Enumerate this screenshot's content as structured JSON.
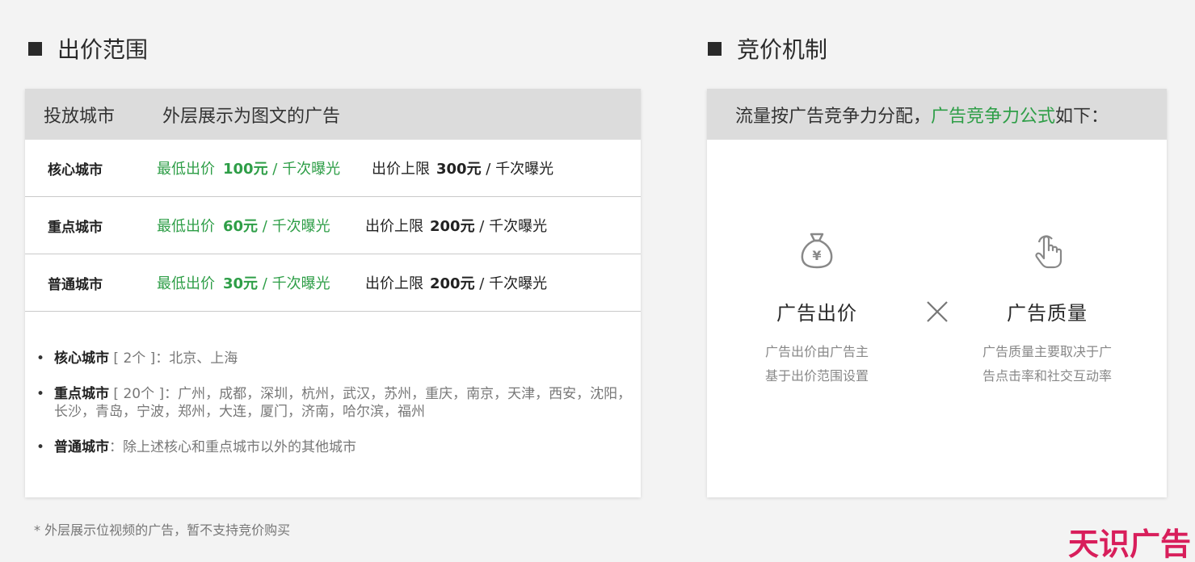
{
  "left_section": {
    "title": "出价范围",
    "table": {
      "header": [
        "投放城市",
        "外层展示为图文的广告"
      ],
      "rows": [
        {
          "city": "核心城市",
          "min_label": "最低出价",
          "min_value": "100元",
          "min_unit": " / 千次曝光",
          "max_label": "出价上限",
          "max_value": "300元",
          "max_unit": " / 千次曝光"
        },
        {
          "city": "重点城市",
          "min_label": "最低出价",
          "min_value": "60元",
          "min_unit": " / 千次曝光",
          "max_label": "出价上限",
          "max_value": "200元",
          "max_unit": " / 千次曝光"
        },
        {
          "city": "普通城市",
          "min_label": "最低出价",
          "min_value": "30元",
          "min_unit": " / 千次曝光",
          "max_label": "出价上限",
          "max_value": "200元",
          "max_unit": " / 千次曝光"
        }
      ]
    },
    "bullets": [
      {
        "key": "核心城市",
        "count": " [ 2个 ]",
        "text": "：北京、上海"
      },
      {
        "key": "重点城市",
        "count": " [ 20个 ]",
        "text": "：广州，成都，深圳，杭州，武汉，苏州，重庆，南京，天津，西安，沈阳，长沙，青岛，宁波，郑州，大连，厦门，济南，哈尔滨，福州"
      },
      {
        "key": "普通城市",
        "count": "",
        "text": "：除上述核心和重点城市以外的其他城市"
      }
    ],
    "note": "* 外层展示位视频的广告，暂不支持竞价购买"
  },
  "right_section": {
    "title": "竞价机制",
    "header_prefix": "流量按广告竞争力分配，",
    "header_highlight": "广告竞争力公式",
    "header_suffix": "如下：",
    "factors": [
      {
        "icon": "money-bag-icon",
        "title": "广告出价",
        "desc_line1": "广告出价由广告主",
        "desc_line2": "基于出价范围设置"
      },
      {
        "icon": "tap-hand-icon",
        "title": "广告质量",
        "desc_line1": "广告质量主要取决于广",
        "desc_line2": "告点击率和社交互动率"
      }
    ],
    "operator_icon": "multiply-icon"
  },
  "logo": "天识广告",
  "colors": {
    "accent_green": "#2e9e47",
    "logo_red": "#d81e5b",
    "header_gray": "#dcdcdc"
  }
}
